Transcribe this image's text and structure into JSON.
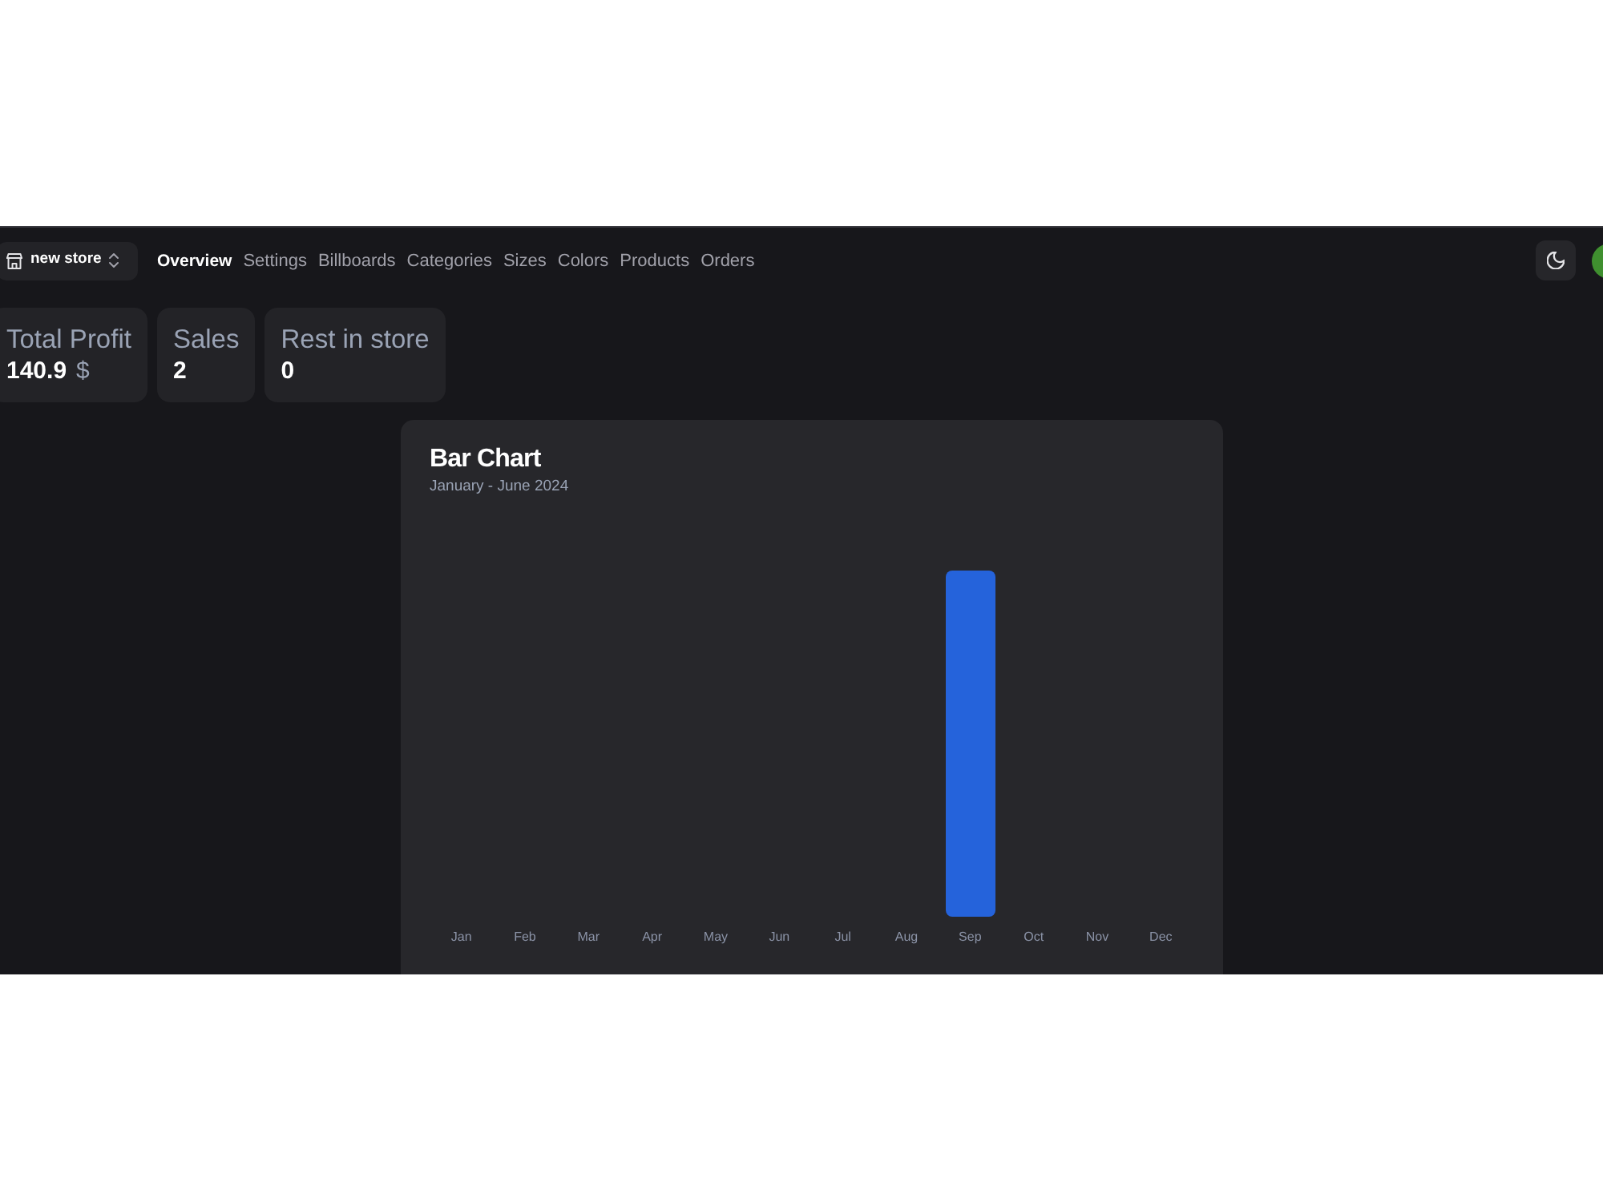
{
  "store_switcher": {
    "label": "new store"
  },
  "nav": [
    {
      "label": "Overview",
      "selected": true
    },
    {
      "label": "Settings",
      "selected": false
    },
    {
      "label": "Billboards",
      "selected": false
    },
    {
      "label": "Categories",
      "selected": false
    },
    {
      "label": "Sizes",
      "selected": false
    },
    {
      "label": "Colors",
      "selected": false
    },
    {
      "label": "Products",
      "selected": false
    },
    {
      "label": "Orders",
      "selected": false
    }
  ],
  "stats": [
    {
      "label": "Total Profit",
      "value": "140.9",
      "unit": "$"
    },
    {
      "label": "Sales",
      "value": "2"
    },
    {
      "label": "Rest in store",
      "value": "0"
    }
  ],
  "chart": {
    "title": "Bar Chart",
    "subtitle": "January - June 2024",
    "months": [
      "Jan",
      "Feb",
      "Mar",
      "Apr",
      "May",
      "Jun",
      "Jul",
      "Aug",
      "Sep",
      "Oct",
      "Nov",
      "Dec"
    ]
  }
}
